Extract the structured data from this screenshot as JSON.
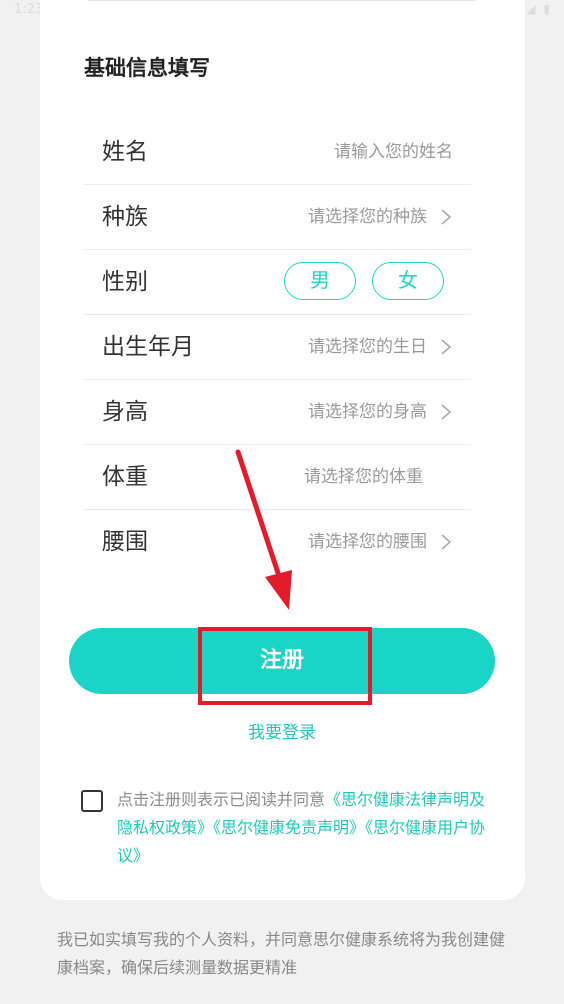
{
  "status_bar": {
    "time": "1:23",
    "right_icons": "◢ ▮"
  },
  "form": {
    "title": "基础信息填写",
    "rows": [
      {
        "label": "姓名",
        "placeholder": "请输入您的姓名"
      },
      {
        "label": "种族",
        "placeholder": "请选择您的种族"
      },
      {
        "label": "性别",
        "options": [
          "男",
          "女"
        ]
      },
      {
        "label": "出生年月",
        "placeholder": "请选择您的生日"
      },
      {
        "label": "身高",
        "placeholder": "请选择您的身高"
      },
      {
        "label": "体重",
        "placeholder": "请选择您的体重"
      },
      {
        "label": "腰围",
        "placeholder": "请选择您的腰围"
      }
    ]
  },
  "actions": {
    "register_label": "注册",
    "login_link": "我要登录"
  },
  "agreement": {
    "prefix": "点击注册则表示已阅读并同意",
    "links": [
      "《思尔健康法律声明及隐私权政策》",
      "《思尔健康免责声明》",
      "《思尔健康用户协议》"
    ]
  },
  "footer_note": "我已如实填写我的个人资料，并同意思尔健康系统将为我创建健康档案，确保后续测量数据更精准",
  "colors": {
    "accent": "#1ad4c6",
    "annotation_red": "#e31b2a"
  },
  "icons": {
    "chevron": "chevron-right-icon",
    "arrow": "red-annotation-arrow-icon"
  }
}
